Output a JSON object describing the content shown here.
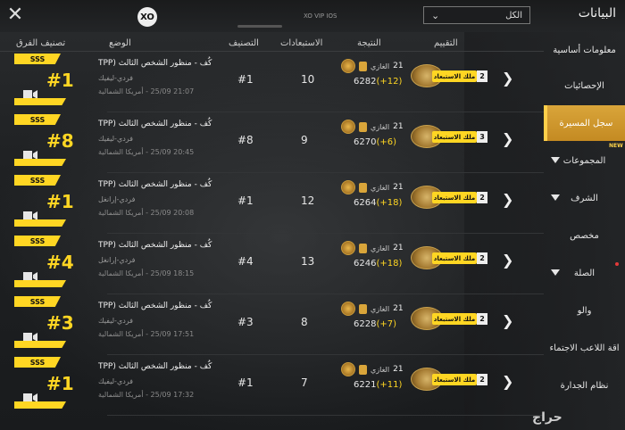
{
  "header": {
    "title": "البيانات",
    "close": "✕",
    "logo": "XO",
    "watermark": "XO VIP IOS",
    "filter": {
      "selected": "الكل"
    }
  },
  "sidebar": {
    "items": [
      {
        "label": "معلومات أساسية"
      },
      {
        "label": "الإحصائيات"
      },
      {
        "label": "سجل المسيرة"
      },
      {
        "label": "المجموعات",
        "badge": "NEW"
      },
      {
        "label": "الشرف"
      },
      {
        "label": "مخصص"
      },
      {
        "label": "الصلة"
      },
      {
        "label": "والو"
      },
      {
        "label": "اقة اللاعب الاجتماء"
      },
      {
        "label": "نظام الجدارة"
      }
    ],
    "active_index": 2
  },
  "columns": {
    "team_rank": "تصنيف الفرق",
    "mode": "الوضع",
    "rank": "التصنيف",
    "kills": "الاستبعادات",
    "result": "النتيجة",
    "rating": "التقييم"
  },
  "rows": [
    {
      "badge": "SSS",
      "rank_big": "#1",
      "mode": "كُف - منظور الشخص الثالث (TPP",
      "sub": "فردي-ليفيك",
      "date": "21:07 25/09 - أمريكا الشمالية",
      "rank": "#1",
      "kills": "10",
      "res_num": "21",
      "res_label": "الغازي",
      "score": "6282",
      "delta": "(+12)",
      "rating_label": "ملك الاستبعاد",
      "rating_num": "2"
    },
    {
      "badge": "SSS",
      "rank_big": "#8",
      "mode": "كُف - منظور الشخص الثالث (TPP",
      "sub": "فردي-ليفيك",
      "date": "20:45 25/09 - أمريكا الشمالية",
      "rank": "#8",
      "kills": "9",
      "res_num": "21",
      "res_label": "الغازي",
      "score": "6270",
      "delta": "(+6)",
      "rating_label": "ملك الاستبعاد",
      "rating_num": "3"
    },
    {
      "badge": "SSS",
      "rank_big": "#1",
      "mode": "كُف - منظور الشخص الثالث (TPP",
      "sub": "فردي-إرانغل",
      "date": "20:08 25/09 - أمريكا الشمالية",
      "rank": "#1",
      "kills": "12",
      "res_num": "21",
      "res_label": "الغازي",
      "score": "6264",
      "delta": "(+18)",
      "rating_label": "ملك الاستبعاد",
      "rating_num": "2"
    },
    {
      "badge": "SSS",
      "rank_big": "#4",
      "mode": "كُف - منظور الشخص الثالث (TPP",
      "sub": "فردي-إرانغل",
      "date": "18:15 25/09 - أمريكا الشمالية",
      "rank": "#4",
      "kills": "13",
      "res_num": "21",
      "res_label": "الغازي",
      "score": "6246",
      "delta": "(+18)",
      "rating_label": "ملك الاستبعاد",
      "rating_num": "2"
    },
    {
      "badge": "SSS",
      "rank_big": "#3",
      "mode": "كُف - منظور الشخص الثالث (TPP",
      "sub": "فردي-ليفيك",
      "date": "17:51 25/09 - أمريكا الشمالية",
      "rank": "#3",
      "kills": "8",
      "res_num": "21",
      "res_label": "الغازي",
      "score": "6228",
      "delta": "(+7)",
      "rating_label": "ملك الاستبعاد",
      "rating_num": "2"
    },
    {
      "badge": "SSS",
      "rank_big": "#1",
      "mode": "كُف - منظور الشخص الثالث (TPP",
      "sub": "فردي-ليفيك",
      "date": "17:32 25/09 - أمريكا الشمالية",
      "rank": "#1",
      "kills": "7",
      "res_num": "21",
      "res_label": "الغازي",
      "score": "6221",
      "delta": "(+11)",
      "rating_label": "ملك الاستبعاد",
      "rating_num": "2"
    }
  ],
  "footer_watermark": "حراج",
  "colors": {
    "accent": "#ffd623",
    "active_tab": "#d9a53a"
  }
}
